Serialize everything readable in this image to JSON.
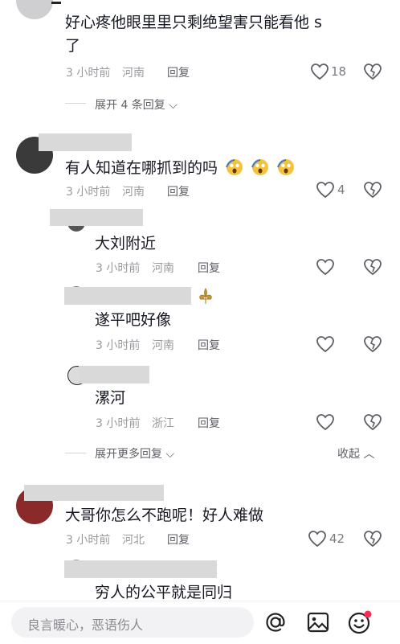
{
  "comment1": {
    "text_line1": "好心疼他眼里里只剩绝望害只能看他 s",
    "text_line2": "了",
    "time": "3 小时前",
    "location": "河南",
    "reply_label": "回复",
    "like_count": "18",
    "expand_label": "展开 4 条回复"
  },
  "comment2": {
    "text": "有人知道在哪抓到的吗",
    "time": "3 小时前",
    "location": "河南",
    "reply_label": "回复",
    "like_count": "4",
    "replies": [
      {
        "text": "大刘附近",
        "time": "3 小时前",
        "location": "河南",
        "reply_label": "回复"
      },
      {
        "text": "遂平吧好像",
        "time": "3 小时前",
        "location": "河南",
        "reply_label": "回复"
      },
      {
        "text": "漯河",
        "time": "3 小时前",
        "location": "浙江",
        "reply_label": "回复"
      }
    ],
    "expand_more_label": "展开更多回复",
    "collapse_label": "收起"
  },
  "comment3": {
    "text": "大哥你怎么不跑呢！好人难做",
    "time": "3 小时前",
    "location": "河北",
    "reply_label": "回复",
    "like_count": "42",
    "reply_text": "穷人的公平就是同归"
  },
  "input": {
    "placeholder": "良言暖心，恶语伤人"
  },
  "colors": {
    "text": "#161823",
    "meta": "#9a9a9f",
    "emoji_face": "#f5c33b"
  }
}
